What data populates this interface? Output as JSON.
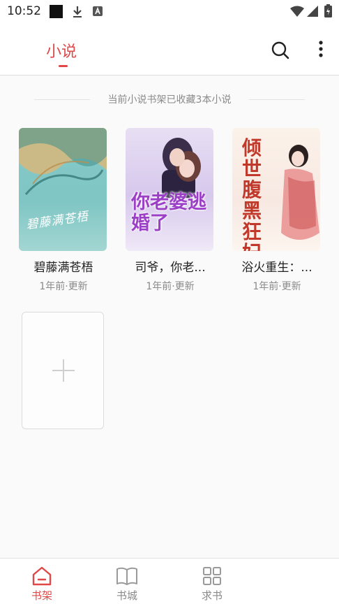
{
  "status_bar": {
    "time": "10:52"
  },
  "header": {
    "title": "小说"
  },
  "shelf_info": "当前小说书架已收藏3本小说",
  "books": [
    {
      "title": "碧藤满苍梧",
      "update": "1年前·更新",
      "cover_text": "碧藤满苍梧",
      "cover_color": "#86c9c9"
    },
    {
      "title": "司爷，你老...",
      "update": "1年前·更新",
      "cover_text": "你老婆逃婚了",
      "cover_color": "#d6c8ec"
    },
    {
      "title": "浴火重生：...",
      "update": "1年前·更新",
      "cover_text": "倾世腹黑狂妃",
      "cover_color": "#f7e8e2"
    }
  ],
  "nav": [
    {
      "label": "书架",
      "icon": "home-icon",
      "active": true
    },
    {
      "label": "书城",
      "icon": "book-icon",
      "active": false
    },
    {
      "label": "求书",
      "icon": "grid-icon",
      "active": false
    }
  ],
  "colors": {
    "accent": "#e04848",
    "muted": "#8a8a8a"
  }
}
